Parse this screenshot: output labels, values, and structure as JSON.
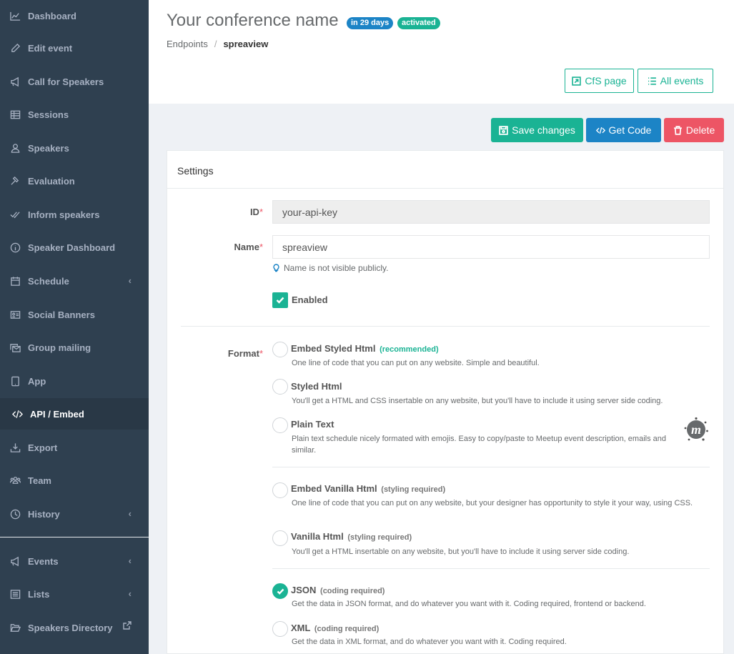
{
  "sidebar": {
    "items": [
      {
        "label": "Dashboard",
        "icon": "chart-icon"
      },
      {
        "label": "Edit event",
        "icon": "pencil-icon"
      },
      {
        "label": "Call for Speakers",
        "icon": "megaphone-icon"
      },
      {
        "label": "Sessions",
        "icon": "table-icon"
      },
      {
        "label": "Speakers",
        "icon": "user-icon"
      },
      {
        "label": "Evaluation",
        "icon": "gavel-icon"
      },
      {
        "label": "Inform speakers",
        "icon": "double-check-icon"
      },
      {
        "label": "Speaker Dashboard",
        "icon": "info-icon"
      },
      {
        "label": "Schedule",
        "icon": "calendar-icon"
      },
      {
        "label": "Social Banners",
        "icon": "id-card-icon"
      },
      {
        "label": "Group mailing",
        "icon": "mail-bulk-icon"
      },
      {
        "label": "App",
        "icon": "tablet-icon"
      },
      {
        "label": "API / Embed",
        "icon": "code-icon"
      },
      {
        "label": "Export",
        "icon": "download-icon"
      },
      {
        "label": "Team",
        "icon": "users-icon"
      },
      {
        "label": "History",
        "icon": "clock-icon"
      },
      {
        "label": "Events",
        "icon": "megaphone-icon"
      },
      {
        "label": "Lists",
        "icon": "list-icon"
      },
      {
        "label": "Speakers Directory",
        "icon": "folder-open-icon"
      }
    ],
    "chevron": "‹"
  },
  "header": {
    "title": "Your conference name",
    "badge_days": "in 29 days",
    "badge_status": "activated",
    "breadcrumb_parent": "Endpoints",
    "breadcrumb_sep": "/",
    "breadcrumb_current": "spreaview",
    "cfs_button": "CfS page",
    "all_events_button": "All events"
  },
  "actions": {
    "save": "Save changes",
    "get_code": "Get Code",
    "delete": "Delete"
  },
  "settings": {
    "title": "Settings",
    "id_label": "ID",
    "id_value": "your-api-key",
    "name_label": "Name",
    "name_value": "spreaview",
    "required_mark": "*",
    "name_hint": "Name is not visible publicly.",
    "enabled_label": "Enabled",
    "enabled": true,
    "format_label": "Format",
    "formats": [
      {
        "title": "Embed Styled Html",
        "tag": "(recommended)",
        "desc": "One line of code that you can put on any website. Simple and beautiful.",
        "checked": false
      },
      {
        "title": "Styled Html",
        "tag": "",
        "desc": "You'll get a HTML and CSS insertable on any website, but you'll have to include it using server side coding.",
        "checked": false
      },
      {
        "title": "Plain Text",
        "tag": "",
        "desc": "Plain text schedule nicely formated with emojis. Easy to copy/paste to Meetup event description, emails and similar.",
        "checked": false
      },
      {
        "title": "Embed Vanilla Html",
        "tag": "(styling required)",
        "desc": "One line of code that you can put on any website, but your designer has opportunity to style it your way, using CSS.",
        "checked": false
      },
      {
        "title": "Vanilla Html",
        "tag": "(styling required)",
        "desc": "You'll get a HTML insertable on any website, but you'll have to include it using server side coding.",
        "checked": false
      },
      {
        "title": "JSON",
        "tag": "(coding required)",
        "desc": "Get the data in JSON format, and do whatever you want with it. Coding required, frontend or backend.",
        "checked": true
      },
      {
        "title": "XML",
        "tag": "(coding required)",
        "desc": "Get the data in XML format, and do whatever you want with it. Coding required.",
        "checked": false
      }
    ]
  },
  "colors": {
    "sidebar_bg": "#2f4050",
    "primary": "#1ab394",
    "info": "#1c84c6",
    "danger": "#ed5565"
  }
}
